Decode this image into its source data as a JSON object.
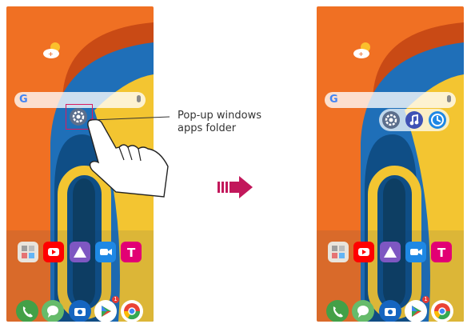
{
  "annotation": {
    "line1": "Pop-up windows",
    "line2": "apps folder"
  },
  "search": {
    "logo": "G"
  },
  "dock_icons": [
    "phone-icon",
    "messages-icon",
    "camera-icon",
    "play-store-icon",
    "chrome-icon"
  ],
  "row_icons": [
    "folder-icon",
    "youtube-icon",
    "lg-app-icon",
    "video-call-icon",
    "t-mobile-icon"
  ],
  "popup_folder_icons_after": [
    "settings-icon",
    "music-icon",
    "clock-icon"
  ],
  "notification_badge": "1",
  "colors": {
    "orange": "#f07023",
    "blue": "#1f6fb8",
    "yellow": "#f3c531",
    "accent": "#c2185b"
  }
}
